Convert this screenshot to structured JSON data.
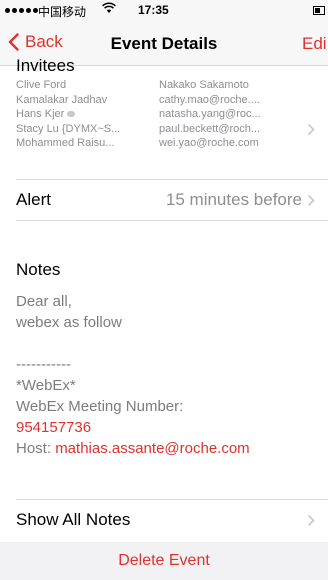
{
  "status_bar": {
    "carrier": "中国移动",
    "wifi_icon": "wifi-icon",
    "time": "17:35"
  },
  "nav": {
    "back_label": "Back",
    "title": "Event Details",
    "edit_label": "Edi"
  },
  "invitees": {
    "title": "Invitees",
    "left": [
      "Clive Ford",
      "Kamalakar Jadhav",
      "Hans Kjer",
      "Stacy Lu {DYMX~S...",
      "Mohammed Raisu..."
    ],
    "right": [
      "Nakako Sakamoto",
      "cathy.mao@roche....",
      "natasha.yang@roc...",
      "paul.beckett@roch...",
      "wei.yao@roche.com"
    ]
  },
  "alert": {
    "label": "Alert",
    "value": "15 minutes before"
  },
  "notes": {
    "title": "Notes",
    "line1": "Dear all,",
    "line2": "webex as follow",
    "separator": "-----------",
    "line3": "*WebEx*",
    "line4": "WebEx Meeting Number:",
    "meeting_number": "954157736",
    "host_label": "Host: ",
    "host_email": "mathias.assante@roche.com"
  },
  "show_all_notes_label": "Show All Notes",
  "delete_label": "Delete Event",
  "colors": {
    "accent": "#e0312e",
    "secondary_text": "#8e8e93"
  }
}
